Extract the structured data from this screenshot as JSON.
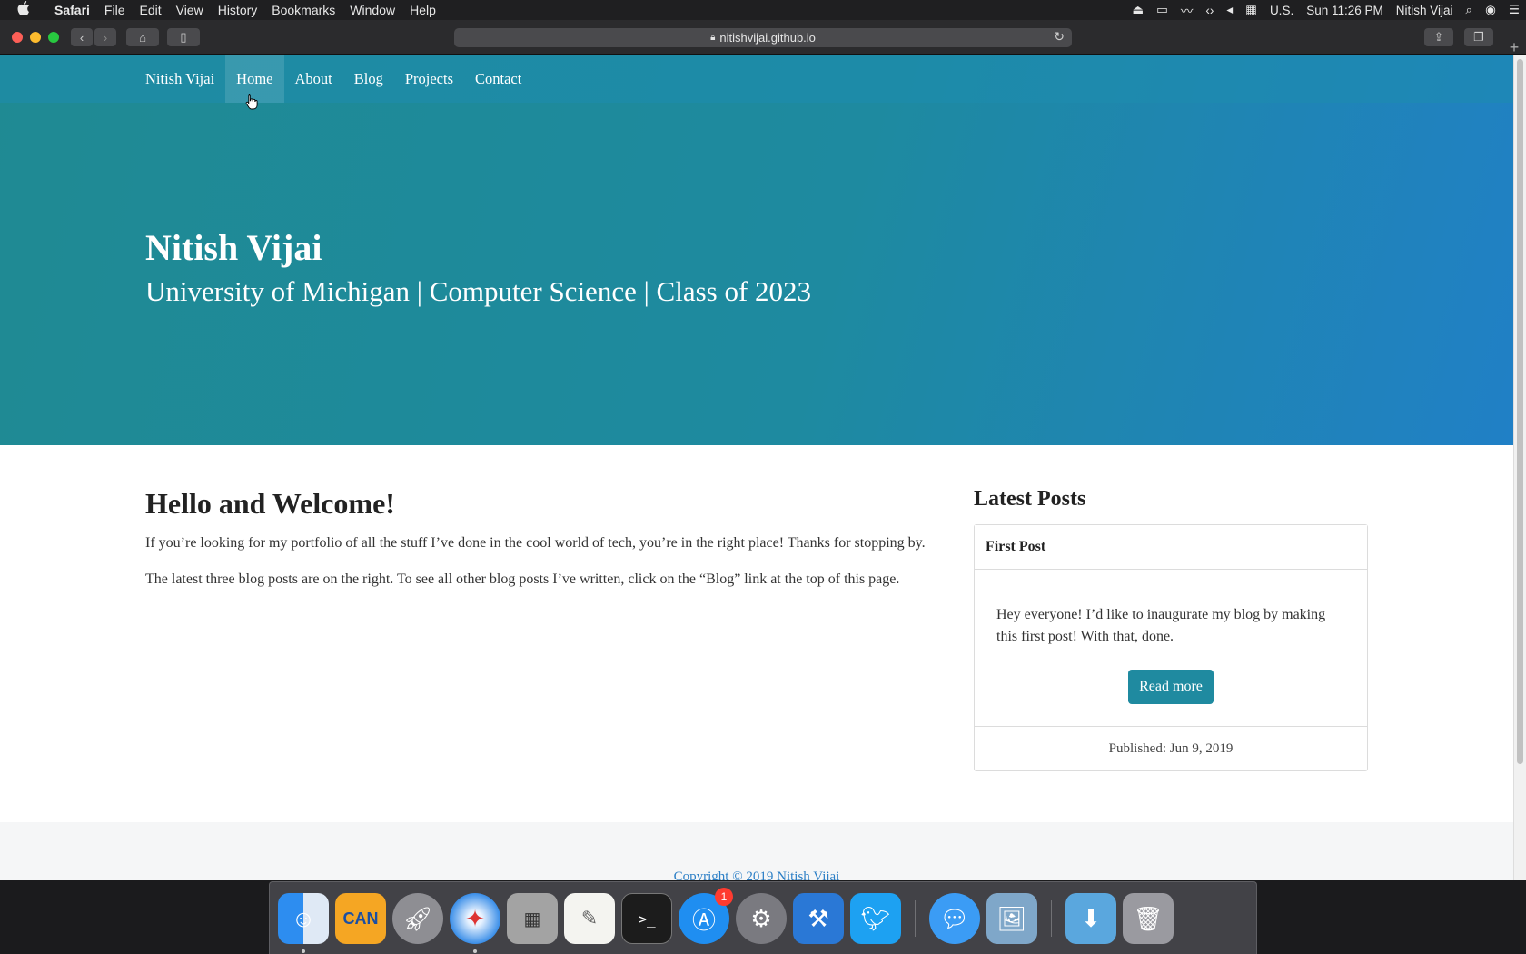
{
  "menubar": {
    "apple": "",
    "app": "Safari",
    "items": [
      "File",
      "Edit",
      "View",
      "History",
      "Bookmarks",
      "Window",
      "Help"
    ],
    "input_source": "U.S.",
    "clock": "Sun 11:26 PM",
    "user": "Nitish Vijai"
  },
  "browser": {
    "url": "nitishvijai.github.io"
  },
  "nav": {
    "brand": "Nitish Vijai",
    "links": [
      "Home",
      "About",
      "Blog",
      "Projects",
      "Contact"
    ],
    "active": "Home"
  },
  "hero": {
    "title": "Nitish Vijai",
    "subtitle": "University of Michigan | Computer Science | Class of 2023"
  },
  "main": {
    "heading": "Hello and Welcome!",
    "paragraphs": [
      "If you’re looking for my portfolio of all the stuff I’ve done in the cool world of tech, you’re in the right place! Thanks for stopping by.",
      "The latest three blog posts are on the right. To see all other blog posts I’ve written, click on the “Blog” link at the top of this page."
    ]
  },
  "sidebar": {
    "heading": "Latest Posts",
    "post": {
      "title": "First Post",
      "excerpt": "Hey everyone! I’d like to inaugurate my blog by making this first post! With that, done.",
      "button": "Read more",
      "published": "Published: Jun 9, 2019"
    }
  },
  "footer": {
    "copyright": "Copyright © 2019 Nitish Vijai"
  },
  "dock": {
    "apps": [
      "finder",
      "can",
      "launchpad",
      "safari",
      "calculator",
      "textedit",
      "terminal",
      "app-store",
      "system-preferences",
      "xcode",
      "twitter",
      "messages",
      "preview",
      "downloads",
      "trash"
    ],
    "app_store_badge": "1"
  },
  "colors": {
    "hero_start": "#1f8a93",
    "hero_end": "#2080c6",
    "accent_button": "#1f8aa0",
    "footer_link": "#2c7fc6"
  }
}
